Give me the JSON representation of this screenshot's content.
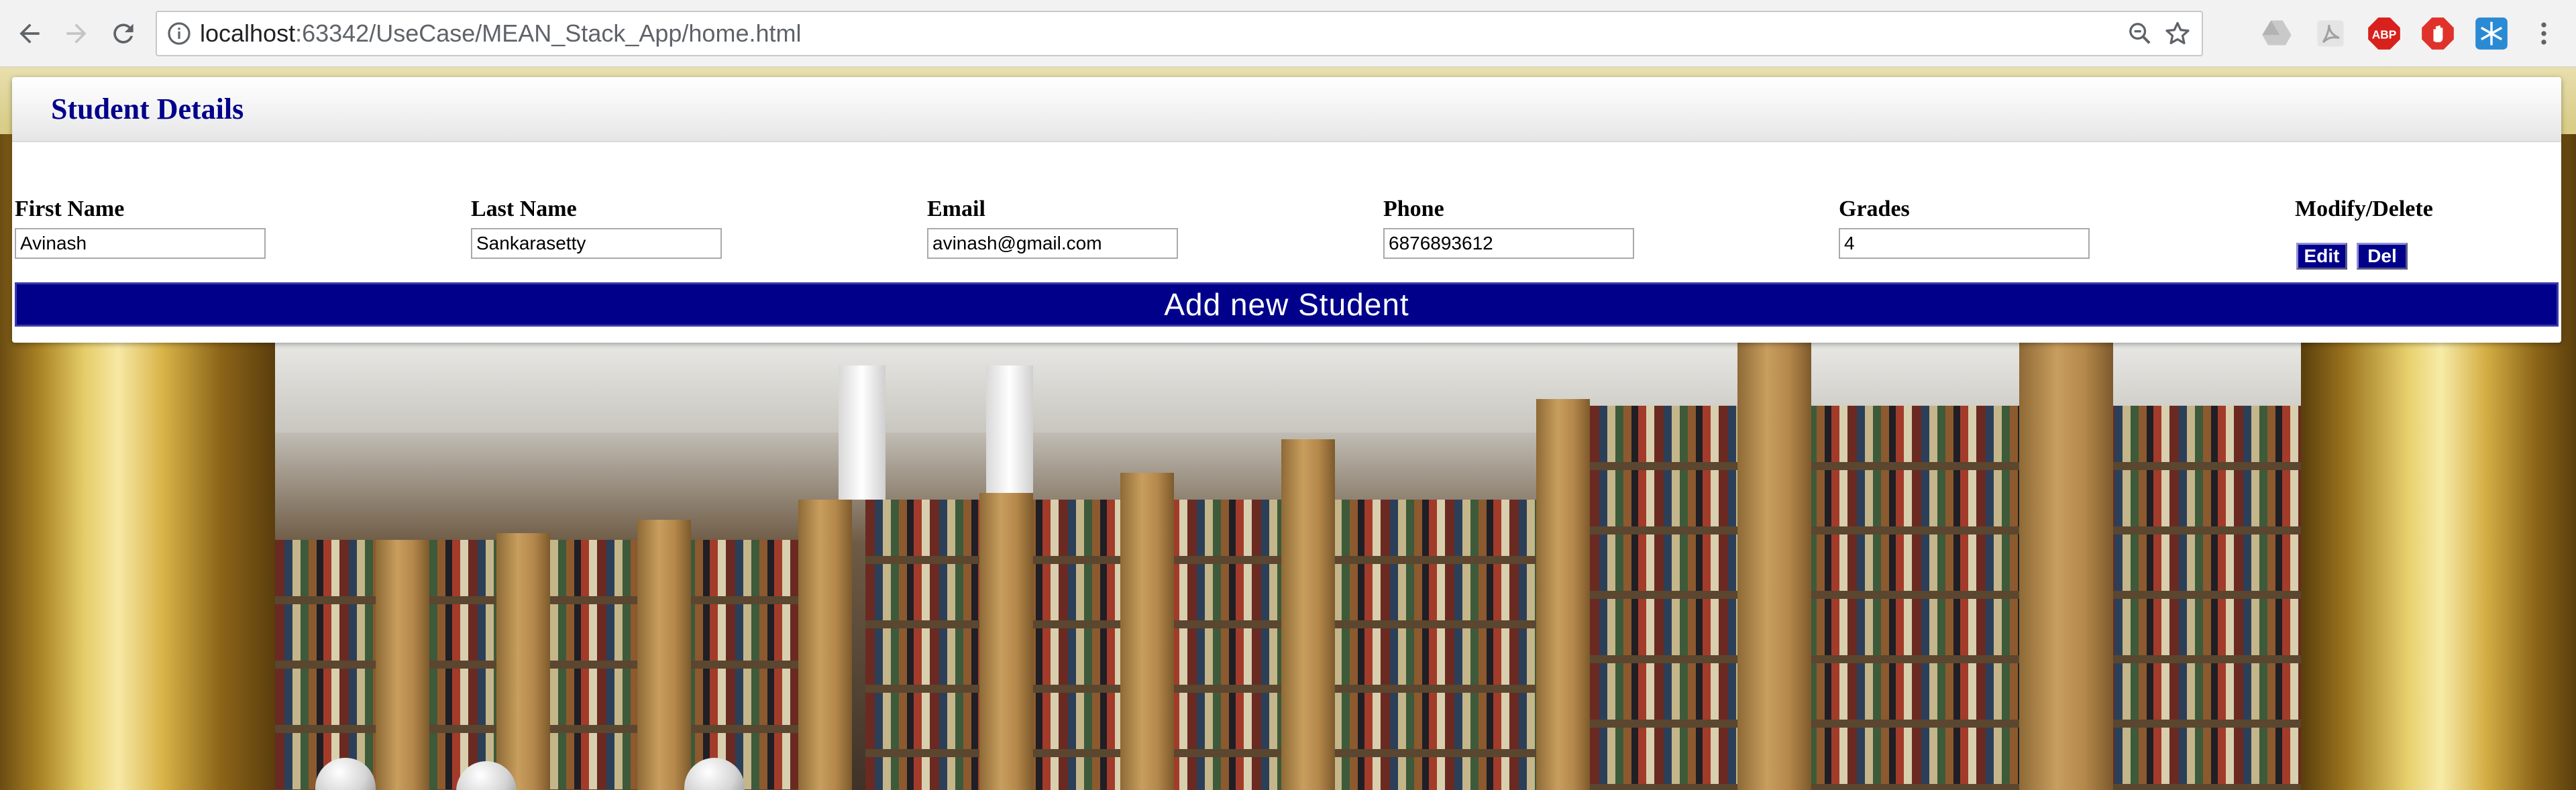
{
  "browser": {
    "url_host": "localhost",
    "url_path": ":63342/UseCase/MEAN_Stack_App/home.html",
    "extensions": [
      "drive-icon",
      "pdf-icon",
      "adblock-plus-icon",
      "stop-hand-icon",
      "snowflake-icon"
    ],
    "extension_labels": {
      "adblock": "ABP"
    }
  },
  "panel": {
    "title": "Student Details",
    "add_button_label": "Add new Student"
  },
  "table": {
    "columns": [
      "First Name",
      "Last Name",
      "Email",
      "Phone",
      "Grades",
      "Modify/Delete"
    ],
    "row": {
      "first_name": "Avinash",
      "last_name": "Sankarasetty",
      "email": "avinash@gmail.com",
      "phone": "6876893612",
      "grades": "4"
    },
    "edit_label": "Edit",
    "delete_label": "Del"
  },
  "colors": {
    "accent": "#00008b",
    "title": "#00008b",
    "button_text": "#ffffff"
  }
}
